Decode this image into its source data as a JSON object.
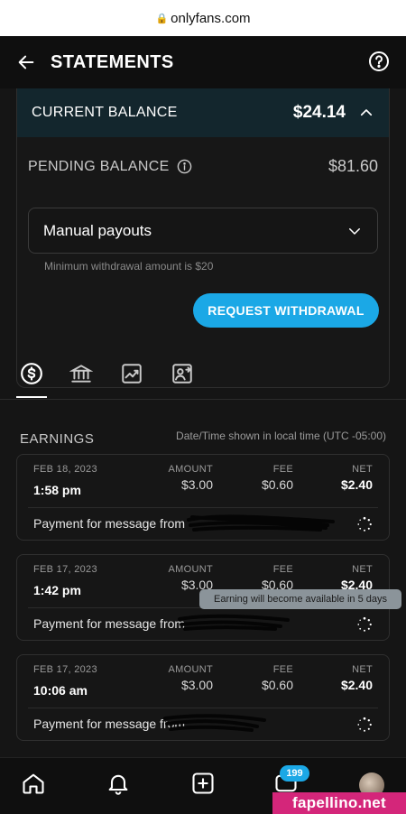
{
  "browser": {
    "url": "onlyfans.com"
  },
  "header": {
    "title": "STATEMENTS"
  },
  "balance": {
    "current_label": "CURRENT BALANCE",
    "current_amount": "$24.14",
    "pending_label": "PENDING BALANCE",
    "pending_amount": "$81.60"
  },
  "payout": {
    "method": "Manual payouts",
    "min_note": "Minimum withdrawal amount is $20",
    "withdraw_label": "REQUEST WITHDRAWAL"
  },
  "tabs": [
    {
      "icon": "dollar-circle-icon",
      "active": true
    },
    {
      "icon": "bank-icon",
      "active": false
    },
    {
      "icon": "chart-icon",
      "active": false
    },
    {
      "icon": "user-transfer-icon",
      "active": false
    }
  ],
  "earnings": {
    "title": "EARNINGS",
    "tz_note": "Date/Time shown in local time (UTC -05:00)",
    "columns": {
      "amount": "AMOUNT",
      "fee": "FEE",
      "net": "NET"
    },
    "rows": [
      {
        "date": "FEB 18, 2023",
        "time": "1:58 pm",
        "amount": "$3.00",
        "fee": "$0.60",
        "net": "$2.40",
        "desc": "Payment for message from"
      },
      {
        "date": "FEB 17, 2023",
        "time": "1:42 pm",
        "amount": "$3.00",
        "fee": "$0.60",
        "net": "$2.40",
        "desc": "Payment for message from"
      },
      {
        "date": "FEB 17, 2023",
        "time": "10:06 am",
        "amount": "$3.00",
        "fee": "$0.60",
        "net": "$2.40",
        "desc": "Payment for message from"
      }
    ],
    "tooltip": "Earning will become available in 5 days"
  },
  "nav": {
    "badge_count": "199"
  },
  "watermark": "fapellino.net",
  "colors": {
    "accent": "#1ba8e6",
    "balance_bg": "#13262d",
    "background": "#151515"
  }
}
